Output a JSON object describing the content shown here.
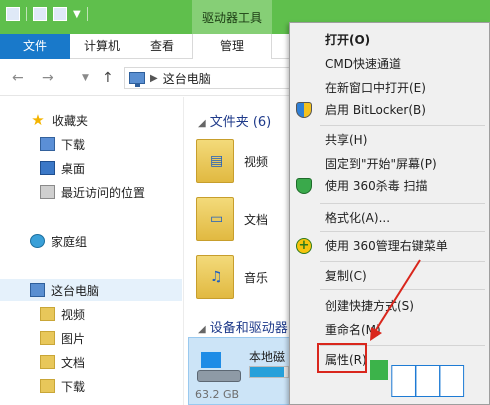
{
  "ribbon": {
    "context_tab_title": "驱动器工具",
    "tabs": {
      "file": "文件",
      "computer": "计算机",
      "view": "查看",
      "manage": "管理"
    }
  },
  "address": {
    "path": "这台电脑"
  },
  "nav": {
    "favorites": "收藏夹",
    "downloads": "下载",
    "desktop": "桌面",
    "recent": "最近访问的位置",
    "homegroup": "家庭组",
    "this_pc": "这台电脑",
    "videos": "视频",
    "pictures": "图片",
    "documents": "文档",
    "downloads2": "下载"
  },
  "content": {
    "folders_header": "文件夹 (6)",
    "folders": [
      {
        "label": "视频"
      },
      {
        "label": "文档"
      },
      {
        "label": "音乐"
      }
    ],
    "devices_header": "设备和驱动器",
    "drive": {
      "name": "本地磁",
      "size": "63.2 GB",
      "used_fraction": 0.9
    }
  },
  "context_menu": {
    "open": "打开(O)",
    "cmd": "CMD快速通道",
    "new_window": "在新窗口中打开(E)",
    "bitlocker": "启用 BitLocker(B)",
    "share": "共享(H)",
    "pin_start": "固定到\"开始\"屏幕(P)",
    "scan360": "使用 360杀毒 扫描",
    "format": "格式化(A)...",
    "manage360": "使用 360管理右键菜单",
    "copy": "复制(C)",
    "shortcut": "创建快捷方式(S)",
    "rename": "重命名(M)",
    "properties": "属性(R)"
  },
  "colors": {
    "titlebar": "#5fbf4c",
    "file_tab": "#1979ca",
    "highlight": "#d9261c"
  }
}
